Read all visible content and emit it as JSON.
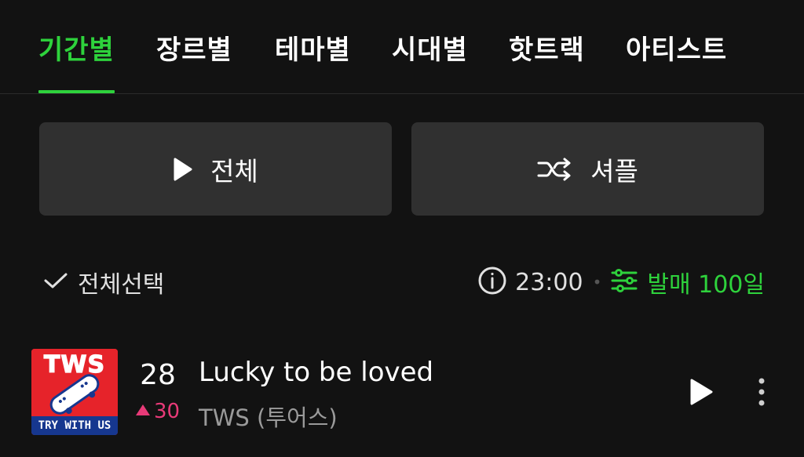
{
  "tabs": [
    {
      "label": "기간별",
      "active": true
    },
    {
      "label": "장르별",
      "active": false
    },
    {
      "label": "테마별",
      "active": false
    },
    {
      "label": "시대별",
      "active": false
    },
    {
      "label": "핫트랙",
      "active": false
    },
    {
      "label": "아티스트",
      "active": false
    }
  ],
  "actions": {
    "play_all_label": "전체",
    "shuffle_label": "셔플"
  },
  "list_controls": {
    "select_all_label": "전체선택",
    "update_time": "23:00",
    "filter_label": "발매 100일"
  },
  "tracks": [
    {
      "rank": "28",
      "rank_change": "30",
      "rank_direction": "up",
      "title": "Lucky to be loved",
      "artist": "TWS (투어스)",
      "album_art_text": "TWS",
      "album_art_caption": "TRY WITH US"
    }
  ],
  "colors": {
    "accent": "#2ed23c",
    "background": "#121212",
    "button_bg": "#303030",
    "rank_up": "#e83a78",
    "secondary_text": "#9a9a9a"
  },
  "icons": {
    "play_all": "play-icon",
    "shuffle": "shuffle-icon",
    "select_all": "check-icon",
    "info": "info-icon",
    "filter": "sliders-icon",
    "rank_up": "triangle-up-icon",
    "row_play": "play-icon",
    "row_more": "more-vertical-icon"
  }
}
